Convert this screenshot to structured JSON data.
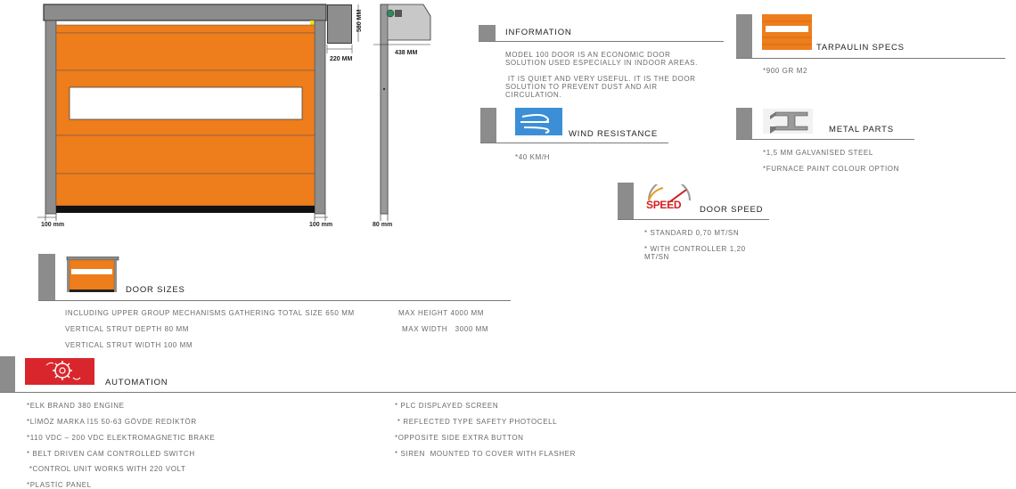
{
  "drawing": {
    "dim_top_side": "580 MM",
    "dim_hood": "220 MM",
    "dim_depth": "438 MM",
    "dim_left": "100 mm",
    "dim_right": "100 mm",
    "dim_strut": "80 mm"
  },
  "information": {
    "title": "INFORMATION",
    "line1": "MODEL 100 DOOR IS AN ECONOMIC DOOR",
    "line2": "SOLUTION USED ESPECIALLY IN INDOOR AREAS.",
    "line3": " IT IS QUIET AND VERY USEFUL. IT IS THE DOOR",
    "line4": "SOLUTION TO PREVENT DUST AND AIR",
    "line5": "CIRCULATION."
  },
  "tarpaulin": {
    "title": "TARPAULIN SPECS",
    "spec": "*900 GR M2"
  },
  "wind": {
    "title": "WIND RESISTANCE",
    "spec": "*40 KM/H"
  },
  "metal": {
    "title": "METAL PARTS",
    "spec1": "*1,5 MM GALVANİSED STEEL",
    "spec2": "*FURNACE PAINT COLOUR OPTION"
  },
  "speed": {
    "title": "DOOR SPEED",
    "logo_text": "SPEED",
    "spec1": "* STANDARD 0,70 MT/SN",
    "spec2_l1": "* WITH CONTROLLER 1,20",
    "spec2_l2": "MT/SN"
  },
  "door_sizes": {
    "title": "DOOR SIZES",
    "line1": "INCLUDING UPPER GROUP  MECHANISMS GATHERING TOTAL SIZE 650 MM",
    "line2": "VERTICAL STRUT DEPTH  80  MM",
    "line3": "VERTICAL STRUT WIDTH 100  MM",
    "max_height": "MAX HEIGHT 4000 MM",
    "max_width": "MAX WIDTH   3000 MM"
  },
  "automation": {
    "title": "AUTOMATION",
    "left": [
      "*ELK BRAND 380 ENGINE",
      "*LİMÖZ MARKA İ15 50-63 GÖVDE REDİKTÖR",
      "*110 VDC – 200 VDC ELEKTROMAGNETIC BRAKE",
      "* BELT DRIVEN CAM CONTROLLED SWITCH",
      " *CONTROL UNIT WORKS WITH 220 VOLT",
      "*PLASTİC PANEL"
    ],
    "right": [
      "* PLC DISPLAYED SCREEN",
      " * REFLECTED TYPE SAFETY PHOTOCELL",
      "*OPPOSITE SIDE EXTRA BUTTON",
      "* SIREN  MOUNTED TO COVER WITH FLASHER"
    ]
  },
  "colors": {
    "orange": "#ee7d1c",
    "frame_grey": "#8e8e8e",
    "accent_bar": "#8c8c8c",
    "wind_icon_bg": "#3c8fd6",
    "automation_icon_bg": "#d9262c"
  }
}
